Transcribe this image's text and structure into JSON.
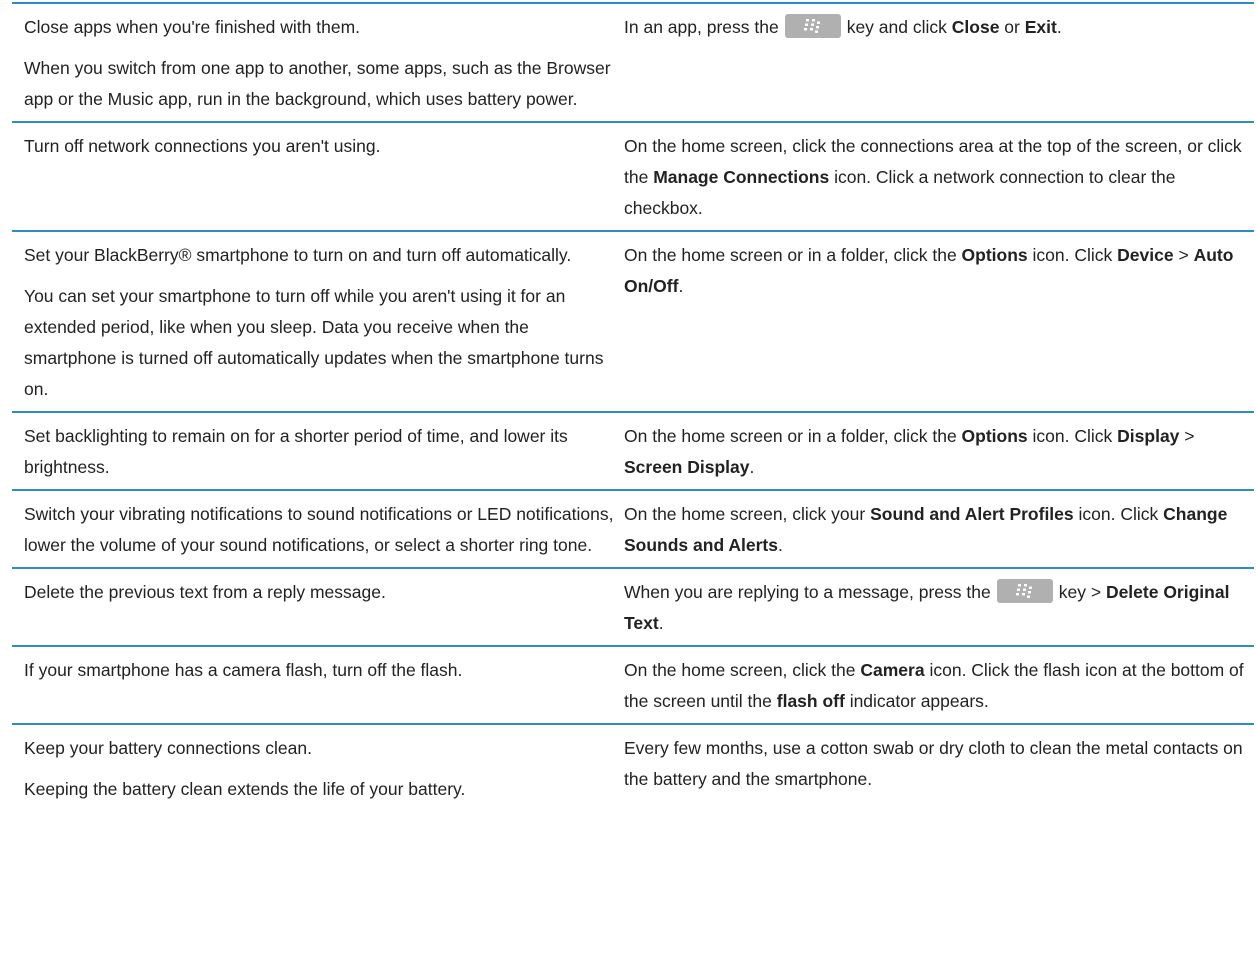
{
  "rows": [
    {
      "tip": [
        "Close apps when you're finished with them.",
        "When you switch from one app to another, some apps, such as the Browser app or the Music app, run in the background, which uses battery power."
      ],
      "action": {
        "t1": "In an app, press the",
        "t2": "key and click",
        "b1": "Close",
        "t3": "or",
        "b2": "Exit",
        "t4": "."
      }
    },
    {
      "tip": [
        "Turn off network connections you aren't using."
      ],
      "action": {
        "t1": "On the home screen, click the connections area at the top of the screen, or click the",
        "b1": "Manage Connections",
        "t2": "icon. Click a network connection to clear the checkbox."
      }
    },
    {
      "tip": [
        "Set your BlackBerry® smartphone to turn on and turn off automatically.",
        "You can set your smartphone to turn off while you aren't using it for an extended period, like when you sleep. Data you receive when the smartphone is turned off automatically updates when the smartphone turns on."
      ],
      "action": {
        "t1": "On the home screen or in a folder, click the",
        "b1": "Options",
        "t2": "icon. Click",
        "b2": "Device",
        "t3": ">",
        "b3": "Auto On/Off",
        "t4": "."
      }
    },
    {
      "tip": [
        "Set backlighting to remain on for a shorter period of time, and lower its brightness."
      ],
      "action": {
        "t1": "On the home screen or in a folder, click the",
        "b1": "Options",
        "t2": "icon. Click",
        "b2": "Display",
        "t3": ">",
        "b3": "Screen Display",
        "t4": "."
      }
    },
    {
      "tip": [
        "Switch your vibrating notifications to sound notifications or LED notifications, lower the volume of your sound notifications, or select a shorter ring tone."
      ],
      "action": {
        "t1": "On the home screen, click your",
        "b1": "Sound and Alert Profiles",
        "t2": "icon. Click",
        "b2": "Change Sounds and Alerts",
        "t3": "."
      }
    },
    {
      "tip": [
        "Delete the previous text from a reply message."
      ],
      "action": {
        "t1": "When you are replying to a message, press the",
        "t2": "key >",
        "b1": "Delete Original Text",
        "t3": "."
      }
    },
    {
      "tip": [
        "If your smartphone has a camera flash, turn off the flash."
      ],
      "action": {
        "t1": "On the home screen, click the",
        "b1": "Camera",
        "t2": "icon. Click the flash icon at the bottom of the screen until the",
        "b2": "flash off",
        "t3": "indicator appears."
      }
    },
    {
      "tip": [
        "Keep your battery connections clean.",
        "Keeping the battery clean extends the life of your battery."
      ],
      "action": {
        "t1": "Every few months, use a cotton swab or dry cloth to clean the metal contacts on the battery and the smartphone."
      }
    }
  ],
  "icons": {
    "menu_key": "blackberry-menu-key-icon"
  },
  "colors": {
    "rule": "#2f8bc6",
    "key_bg": "#b0b0b0"
  }
}
